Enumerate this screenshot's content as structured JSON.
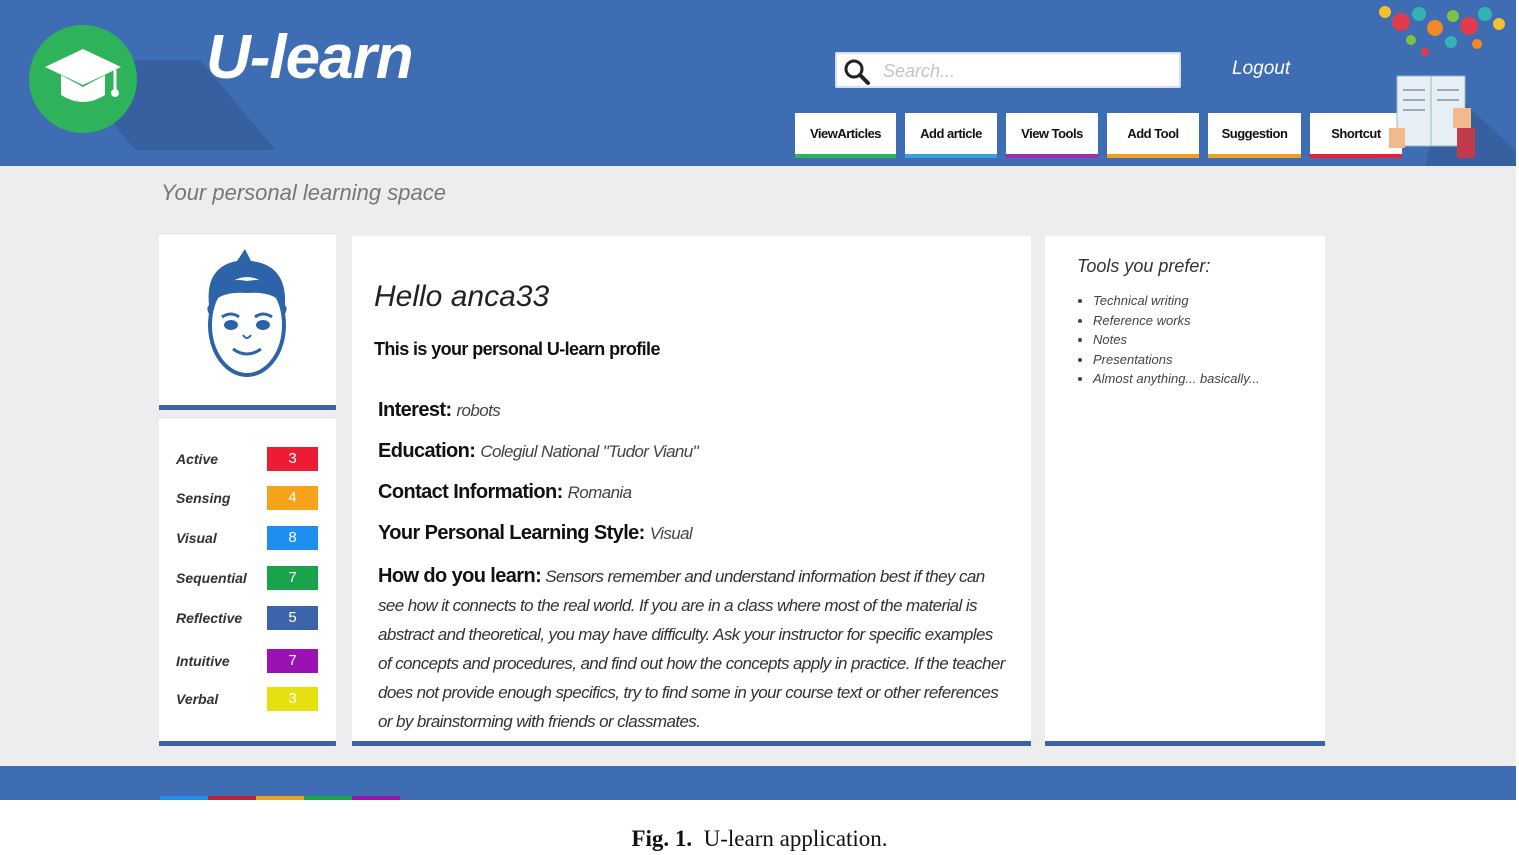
{
  "header": {
    "brand": "U-learn",
    "search_placeholder": "Search...",
    "logout_label": "Logout",
    "nav": [
      {
        "label": "ViewArticles",
        "color": "#2eb35a"
      },
      {
        "label": "Add article",
        "color": "#3aa0e0"
      },
      {
        "label": "View Tools",
        "color": "#9c2fb0"
      },
      {
        "label": "Add Tool",
        "color": "#f0a020"
      },
      {
        "label": "Suggestion",
        "color": "#f0a020"
      },
      {
        "label": "Shortcut",
        "color": "#e8203a"
      }
    ]
  },
  "tagline": "Your personal learning space",
  "learning_styles": [
    {
      "label": "Active",
      "value": "3",
      "color": "#ee1c33"
    },
    {
      "label": "Sensing",
      "value": "4",
      "color": "#f7a21b"
    },
    {
      "label": "Visual",
      "value": "8",
      "color": "#1e8ef0"
    },
    {
      "label": "Sequential",
      "value": "7",
      "color": "#19a34a"
    },
    {
      "label": "Reflective",
      "value": "5",
      "color": "#3c64ab"
    },
    {
      "label": "Intuitive",
      "value": "7",
      "color": "#9b12b4"
    },
    {
      "label": "Verbal",
      "value": "3",
      "color": "#e5e00e"
    }
  ],
  "profile": {
    "greeting": "Hello anca33",
    "subtitle": "This is your personal U-learn profile",
    "interest_label": "Interest:",
    "interest_value": "robots",
    "education_label": "Education:",
    "education_value": "Colegiul National \"Tudor Vianu\"",
    "contact_label": "Contact Information:",
    "contact_value": "Romania",
    "style_label": "Your Personal Learning Style:",
    "style_value": "Visual",
    "learn_label": "How do you learn:",
    "learn_text": "Sensors remember and understand information best if they can see how it connects to the real world. If you are in a class where most of the material is abstract and theoretical, you may have difficulty. Ask your instructor for specific examples of concepts and procedures, and find out how the concepts apply in practice. If the teacher does not provide enough specifics, try to find some in your course text or other references or by brainstorming with friends or classmates."
  },
  "tools": {
    "title": "Tools you prefer:",
    "items": [
      "Technical writing",
      "Reference works",
      "Notes",
      "Presentations",
      "Almost anything... basically..."
    ]
  },
  "caption": {
    "label": "Fig. 1.",
    "text": "U-learn application."
  },
  "footer_stripe_colors": [
    "#1e8ef0",
    "#c0203a",
    "#f0a020",
    "#19a34a",
    "#9b12b4"
  ]
}
